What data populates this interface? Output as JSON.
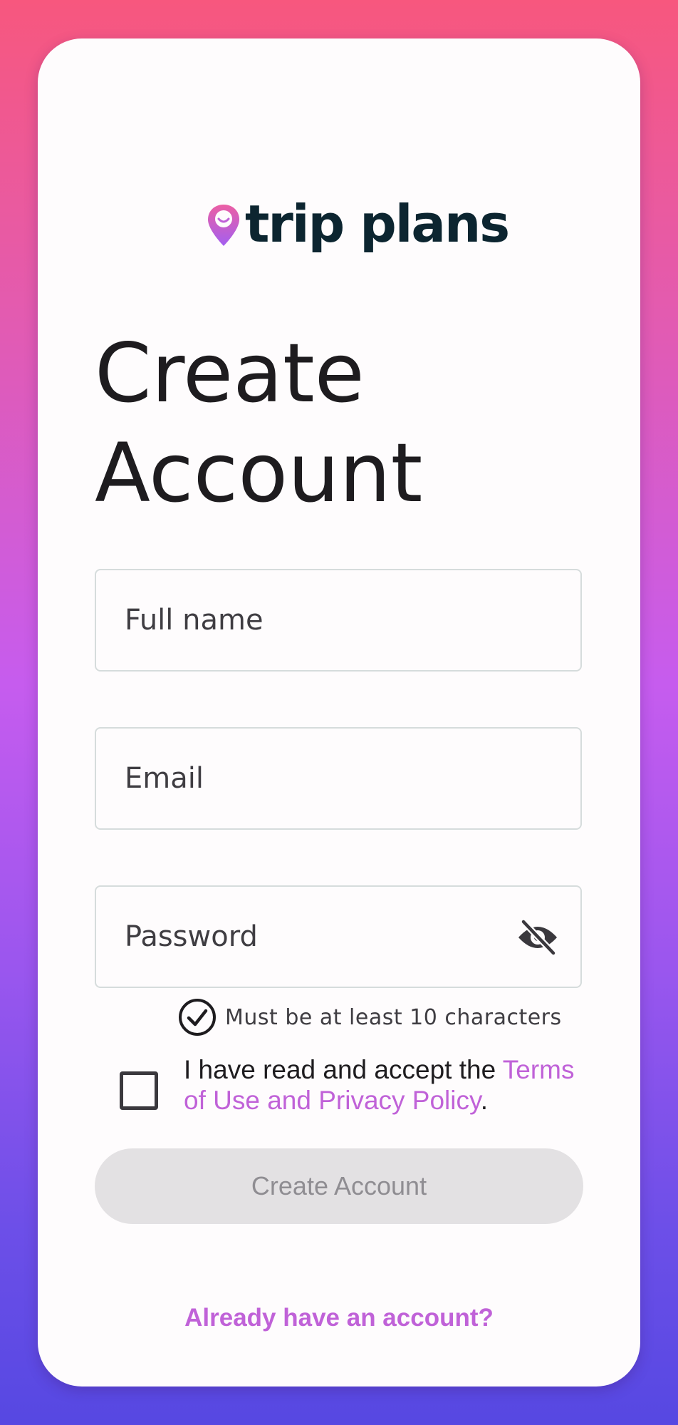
{
  "brand": {
    "name": "trip plans",
    "logo_icon": "map-pin-smile-icon",
    "pin_gradient": [
      "#ec5fa4",
      "#a35ff0"
    ]
  },
  "page": {
    "title_line1": "Create",
    "title_line2": "Account"
  },
  "form": {
    "full_name": {
      "placeholder": "Full name",
      "value": ""
    },
    "email": {
      "placeholder": "Email",
      "value": ""
    },
    "password": {
      "placeholder": "Password",
      "value": "",
      "visibility_icon": "eye-off-icon"
    },
    "password_hint": {
      "icon": "check-circle-icon",
      "text": "Must be at least 10 characters"
    },
    "terms": {
      "checked": false,
      "prefix": "I have read and accept the ",
      "link": "Terms of Use and Privacy Policy",
      "suffix": "."
    },
    "submit_label": "Create Account",
    "submit_enabled": false
  },
  "footer": {
    "signin_link": "Already have an account?"
  },
  "colors": {
    "accent": "#c062d8",
    "text": "#1e1c1f",
    "disabled_bg": "#e3e1e3",
    "disabled_text": "#8f8d92"
  }
}
